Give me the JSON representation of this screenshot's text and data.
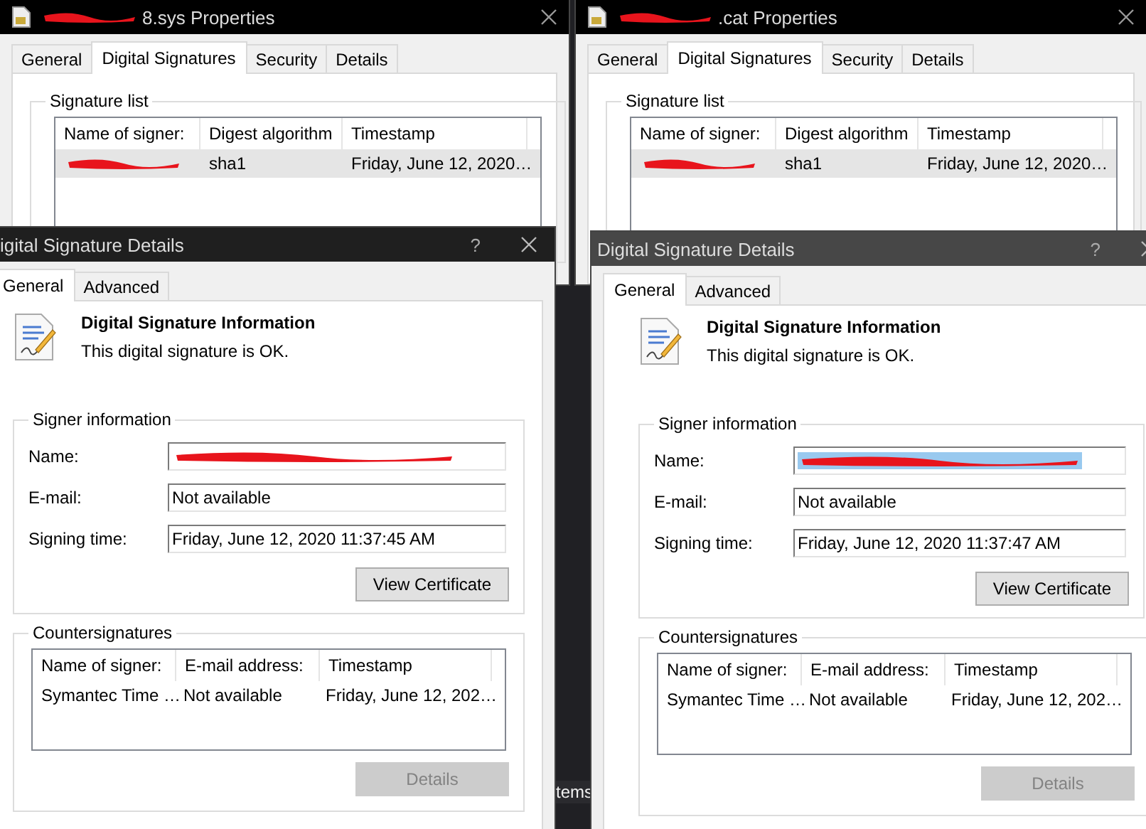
{
  "desktop": {
    "text_fragment": "tems"
  },
  "properties_windows": [
    {
      "title": "8.sys Properties",
      "title_redacted": true,
      "active": false,
      "tabs": [
        {
          "label": "General",
          "selected": false
        },
        {
          "label": "Digital Signatures",
          "selected": true
        },
        {
          "label": "Security",
          "selected": false
        },
        {
          "label": "Details",
          "selected": false
        }
      ],
      "group_label": "Signature list",
      "columns": [
        "Name of signer:",
        "Digest algorithm",
        "Timestamp"
      ],
      "rows": [
        {
          "name_redacted": true,
          "digest": "sha1",
          "timestamp": "Friday, June 12, 2020…",
          "selected": true
        }
      ]
    },
    {
      "title": ".cat Properties",
      "title_redacted": true,
      "active": false,
      "tabs": [
        {
          "label": "General",
          "selected": false
        },
        {
          "label": "Digital Signatures",
          "selected": true
        },
        {
          "label": "Security",
          "selected": false
        },
        {
          "label": "Details",
          "selected": false
        }
      ],
      "group_label": "Signature list",
      "columns": [
        "Name of signer:",
        "Digest algorithm",
        "Timestamp"
      ],
      "rows": [
        {
          "name_redacted": true,
          "digest": "sha1",
          "timestamp": "Friday, June 12, 2020…",
          "selected": true
        }
      ]
    }
  ],
  "details_dialogs": [
    {
      "title": "igital Signature Details",
      "help": "?",
      "active": true,
      "tabs": [
        {
          "label": "General",
          "selected": true
        },
        {
          "label": "Advanced",
          "selected": false
        }
      ],
      "heading": "Digital Signature Information",
      "status": "This digital signature is OK.",
      "signer_group": "Signer information",
      "fields": [
        {
          "label": "Name:",
          "redacted": true,
          "highlighted": false
        },
        {
          "label": "E-mail:",
          "value": "Not available",
          "redacted": false,
          "highlighted": false
        },
        {
          "label": "Signing time:",
          "value": "Friday, June 12, 2020 11:37:45 AM",
          "redacted": false,
          "highlighted": false
        }
      ],
      "view_button": "View Certificate",
      "counter_group": "Countersignatures",
      "counter_columns": [
        "Name of signer:",
        "E-mail address:",
        "Timestamp"
      ],
      "counter_rows": [
        {
          "cells": [
            "Symantec Time …",
            "Not available",
            "Friday, June 12, 202…"
          ]
        }
      ],
      "details_button": {
        "label": "Details",
        "disabled": true
      }
    },
    {
      "title": "Digital Signature Details",
      "help": "?",
      "active": false,
      "tabs": [
        {
          "label": "General",
          "selected": true
        },
        {
          "label": "Advanced",
          "selected": false
        }
      ],
      "heading": "Digital Signature Information",
      "status": "This digital signature is OK.",
      "signer_group": "Signer information",
      "fields": [
        {
          "label": "Name:",
          "redacted": true,
          "highlighted": true
        },
        {
          "label": "E-mail:",
          "value": "Not available",
          "redacted": false,
          "highlighted": false
        },
        {
          "label": "Signing time:",
          "value": "Friday, June 12, 2020 11:37:47 AM",
          "redacted": false,
          "highlighted": false
        }
      ],
      "view_button": "View Certificate",
      "counter_group": "Countersignatures",
      "counter_columns": [
        "Name of signer:",
        "E-mail address:",
        "Timestamp"
      ],
      "counter_rows": [
        {
          "cells": [
            "Symantec Time …",
            "Not available",
            "Friday, June 12, 202…"
          ]
        }
      ],
      "details_button": {
        "label": "Details",
        "disabled": true
      }
    }
  ]
}
